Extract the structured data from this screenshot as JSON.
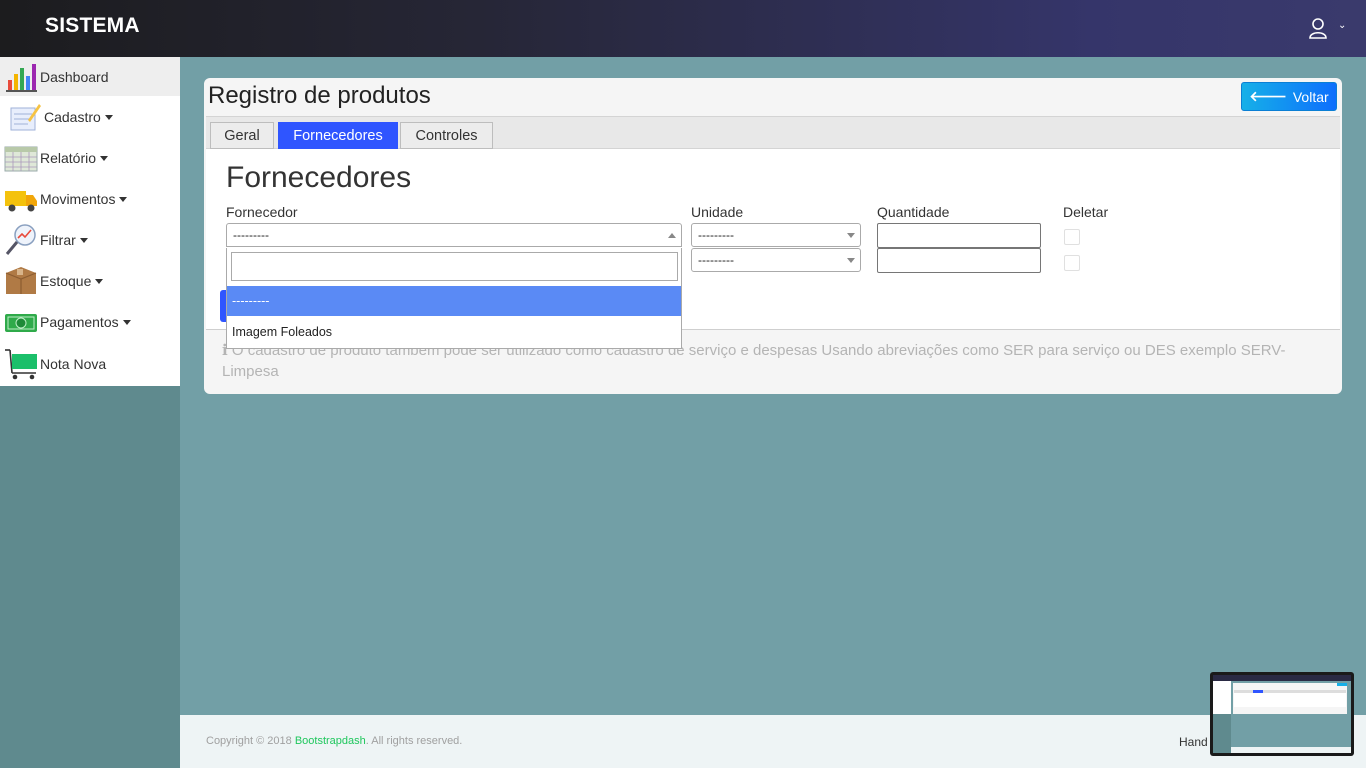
{
  "navbar": {
    "brand": "SISTEMA",
    "user_icon": "user-icon",
    "caret": "⌄"
  },
  "sidebar": {
    "items": [
      {
        "label": "Dashboard",
        "icon": "bar-chart-icon",
        "has_caret": false,
        "active": true
      },
      {
        "label": "Cadastro",
        "icon": "notepad-pencil-icon",
        "has_caret": true
      },
      {
        "label": "Relatório",
        "icon": "calendar-grid-icon",
        "has_caret": true
      },
      {
        "label": "Movimentos",
        "icon": "truck-icon",
        "has_caret": true
      },
      {
        "label": "Filtrar",
        "icon": "magnifier-chart-icon",
        "has_caret": true
      },
      {
        "label": "Estoque",
        "icon": "box-icon",
        "has_caret": true
      },
      {
        "label": "Pagamentos",
        "icon": "cash-icon",
        "has_caret": true
      },
      {
        "label": "Nota Nova",
        "icon": "cart-icon",
        "has_caret": false
      }
    ]
  },
  "card": {
    "title": "Registro de produtos",
    "back_button": "Voltar",
    "tabs": [
      {
        "label": "Geral",
        "active": false
      },
      {
        "label": "Fornecedores",
        "active": true
      },
      {
        "label": "Controles",
        "active": false
      }
    ],
    "section_title": "Fornecedores",
    "columns": {
      "supplier": "Fornecedor",
      "unit": "Unidade",
      "quantity": "Quantidade",
      "delete": "Deletar"
    },
    "rows": [
      {
        "supplier": "---------",
        "unit": "---------",
        "quantity": ""
      },
      {
        "supplier": "",
        "unit": "---------",
        "quantity": ""
      }
    ],
    "dropdown": {
      "search_value": "",
      "options": [
        "---------",
        "Imagem Foleados"
      ],
      "selected_index": 0
    },
    "info_text": "O cadastro de produto também pode ser utilizado como cadastro de serviço e despesas Usando abreviações como SER para serviço ou DES exemplo SERV-Limpesa"
  },
  "footer": {
    "copyright_prefix": "Copyright © 2018 ",
    "brand": "Bootstrapdash",
    "copyright_suffix": ". All rights reserved.",
    "right_text": "Hand"
  },
  "colors": {
    "accent": "#2f55ff",
    "navbar_dark": "#1c1c1e",
    "navbar_light": "#3a3a6c",
    "background": "#729fa6",
    "footer_brand": "#1fc75d"
  }
}
